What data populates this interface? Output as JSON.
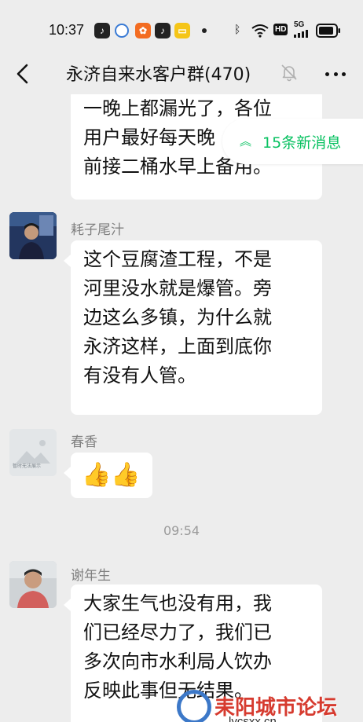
{
  "status_bar": {
    "time": "10:37",
    "network": "5G",
    "hd": "HD"
  },
  "header": {
    "title": "永济自来水客户群(470)"
  },
  "new_messages": {
    "label": "15条新消息",
    "arrows": "︽"
  },
  "messages": [
    {
      "id": "msg-partial",
      "sender": "",
      "text": "一晚上都漏光了，各位\n用户最好每天晚\n前接二桶水早上备用。"
    },
    {
      "id": "msg-1",
      "sender": "耗子尾汁",
      "text": "这个豆腐渣工程，不是\n河里没水就是爆管。旁\n边这么多镇，为什么就\n永济这样，上面到底你\n有没有人管。"
    },
    {
      "id": "msg-2",
      "sender": "春香",
      "text": "👍👍",
      "avatar_caption": "暂时无法展示"
    },
    {
      "id": "msg-3",
      "sender": "谢年生",
      "text": "大家生气也没有用，我\n们已经尽力了，我们已\n多次向市水利局人饮办\n反映此事但无结果。"
    }
  ],
  "timestamp": "09:54",
  "watermark": {
    "name": "耒阳城市论坛",
    "url": "lycsxx.cn"
  },
  "colors": {
    "background": "#ededed",
    "bubble": "#ffffff",
    "accent_green": "#07c160",
    "sender_grey": "#808080"
  }
}
